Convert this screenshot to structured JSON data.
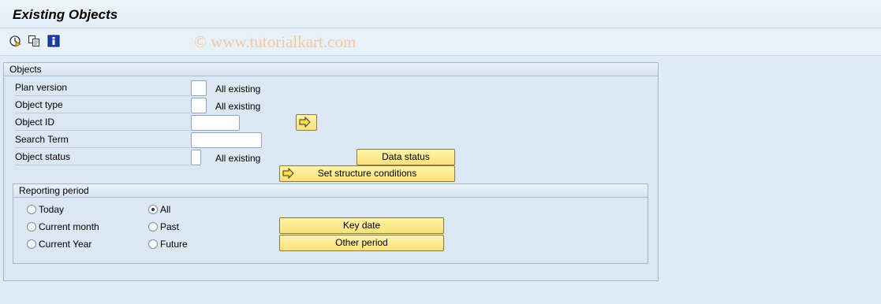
{
  "window": {
    "title": "Existing Objects"
  },
  "toolbar": {
    "icons": [
      "execute-icon",
      "copy-icon",
      "info-icon"
    ]
  },
  "watermark": "© www.tutorialkart.com",
  "objects": {
    "header": "Objects",
    "fields": {
      "plan_version": {
        "label": "Plan version",
        "value": "",
        "suffix": "All existing"
      },
      "object_type": {
        "label": "Object type",
        "value": "",
        "suffix": "All existing"
      },
      "object_id": {
        "label": "Object ID",
        "value": ""
      },
      "search_term": {
        "label": "Search Term",
        "value": ""
      },
      "object_status": {
        "label": "Object status",
        "value": "",
        "suffix": "All existing"
      }
    },
    "buttons": {
      "data_status": "Data status",
      "set_structure_conditions": "Set structure conditions"
    }
  },
  "reporting_period": {
    "header": "Reporting period",
    "options": {
      "today": {
        "label": "Today",
        "checked": false
      },
      "current_month": {
        "label": "Current month",
        "checked": false
      },
      "current_year": {
        "label": "Current Year",
        "checked": false
      },
      "all": {
        "label": "All",
        "checked": true
      },
      "past": {
        "label": "Past",
        "checked": false
      },
      "future": {
        "label": "Future",
        "checked": false
      }
    },
    "buttons": {
      "key_date": "Key date",
      "other_period": "Other period"
    }
  },
  "colors": {
    "background": "#dfebf5",
    "button_yellow": "#fbe17a",
    "group_border": "#9fb6cd"
  }
}
